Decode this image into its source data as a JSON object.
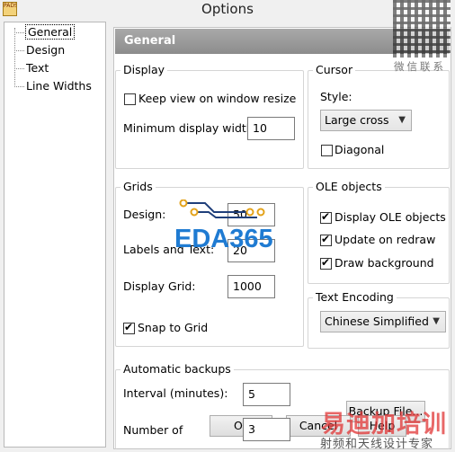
{
  "window": {
    "title": "Options",
    "app_icon_text": "PADS"
  },
  "tree": {
    "items": [
      {
        "label": "General",
        "selected": true
      },
      {
        "label": "Design"
      },
      {
        "label": "Text"
      },
      {
        "label": "Line Widths"
      }
    ]
  },
  "panel": {
    "heading": "General",
    "display": {
      "legend": "Display",
      "keep_view_label": "Keep view on window resize",
      "keep_view_checked": false,
      "min_width_label": "Minimum display width:",
      "min_width_value": "10"
    },
    "cursor": {
      "legend": "Cursor",
      "style_label": "Style:",
      "style_value": "Large cross",
      "diagonal_label": "Diagonal",
      "diagonal_checked": false
    },
    "grids": {
      "legend": "Grids",
      "design_label": "Design:",
      "design_value": "50",
      "labels_label": "Labels and Text:",
      "labels_value": "20",
      "display_grid_label": "Display Grid:",
      "display_grid_value": "1000",
      "snap_label": "Snap to Grid",
      "snap_checked": true
    },
    "ole": {
      "legend": "OLE objects",
      "display_label": "Display OLE objects",
      "update_label": "Update on redraw",
      "background_label": "Draw background"
    },
    "encoding": {
      "legend": "Text Encoding",
      "value": "Chinese Simplified"
    },
    "backups": {
      "legend": "Automatic backups",
      "interval_label": "Interval (minutes):",
      "interval_value": "5",
      "number_label": "Number of",
      "number_value": "3",
      "backup_file_button": "Backup File..."
    }
  },
  "buttons": {
    "ok": "O",
    "cancel": "Cancel",
    "help": "Help"
  },
  "watermarks": {
    "top_right": "微信联系",
    "logo": "EDA365",
    "bottom_large": "易迪加培训",
    "bottom_small": "射频和天线设计专家"
  },
  "colors": {
    "header_bg": "#999999",
    "logo_blue": "#1f7bd2",
    "watermark_red": "#e03434"
  }
}
